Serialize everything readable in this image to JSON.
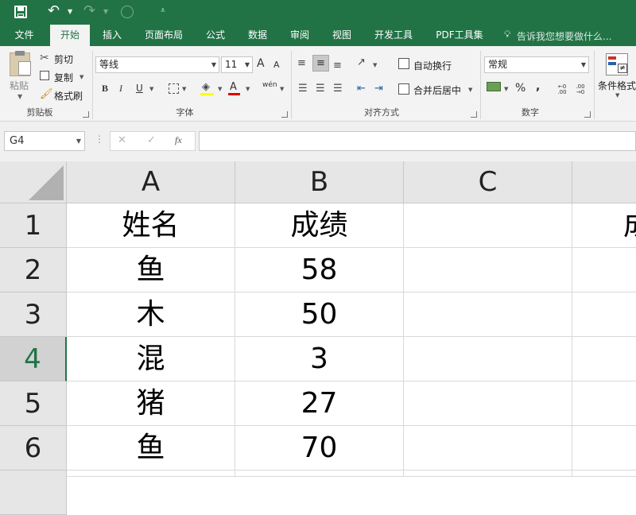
{
  "quick_access": {
    "save_icon": "save-icon",
    "undo_icon": "undo-icon",
    "redo_icon": "redo-icon"
  },
  "tabs": [
    "文件",
    "开始",
    "插入",
    "页面布局",
    "公式",
    "数据",
    "审阅",
    "视图",
    "开发工具",
    "PDF工具集"
  ],
  "tell_me": "告诉我您想要做什么...",
  "ribbon": {
    "clipboard": {
      "paste": "粘贴",
      "cut": "剪切",
      "copy": "复制",
      "format_painter": "格式刷",
      "label": "剪贴板"
    },
    "font": {
      "name": "等线",
      "size": "11",
      "grow": "A",
      "shrink": "A",
      "bold": "B",
      "italic": "I",
      "underline": "U",
      "font_color": "A",
      "phonetic": "wén",
      "label": "字体"
    },
    "alignment": {
      "wrap": "自动换行",
      "merge": "合并后居中",
      "label": "对齐方式"
    },
    "number": {
      "format": "常规",
      "percent": "%",
      "comma": ",",
      "inc_dec": "←0 .00",
      "dec_dec": ".00 →0",
      "label": "数字"
    },
    "styles": {
      "conditional": "条件格式"
    }
  },
  "formula_bar": {
    "name_box": "G4",
    "cancel": "✕",
    "enter": "✓",
    "fx": "fx",
    "value": ""
  },
  "sheet": {
    "columns": [
      "A",
      "B",
      "C",
      ""
    ],
    "rows": [
      "1",
      "2",
      "3",
      "4",
      "5",
      "6"
    ],
    "selected_row": "4",
    "cells": [
      [
        "姓名",
        "成绩",
        "",
        "成"
      ],
      [
        "鱼",
        "58",
        "",
        ""
      ],
      [
        "木",
        "50",
        "",
        ""
      ],
      [
        "混",
        "3",
        "",
        ""
      ],
      [
        "猪",
        "27",
        "",
        ""
      ],
      [
        "鱼",
        "70",
        "",
        ""
      ]
    ]
  },
  "colors": {
    "accent": "#217346",
    "header_bg": "#e6e6e6",
    "ribbon_bg": "#f3f3f3"
  }
}
